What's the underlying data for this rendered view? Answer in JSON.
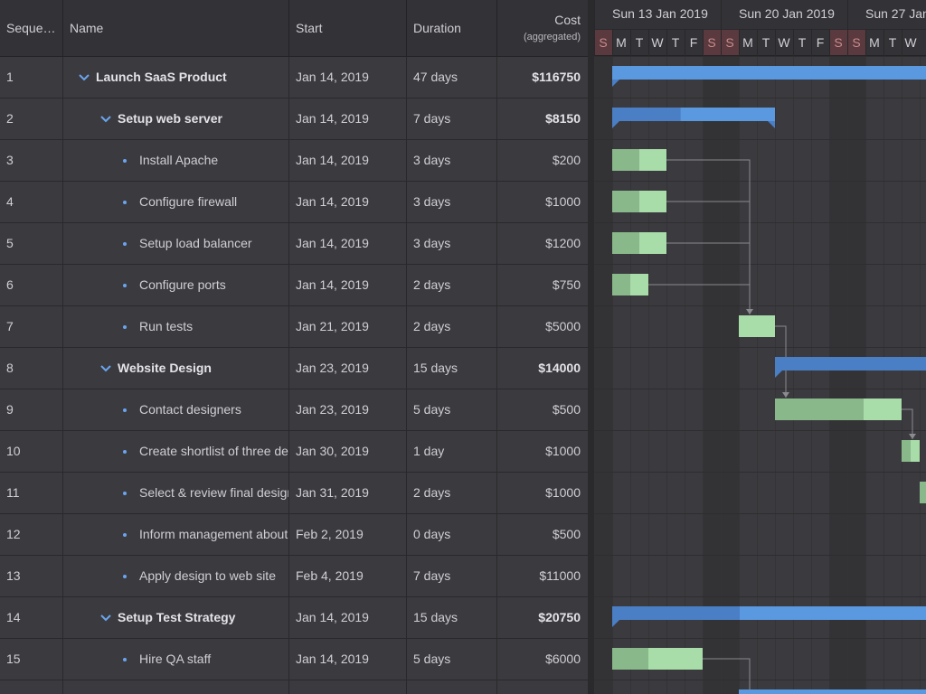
{
  "columns": {
    "seq": "Seque…",
    "name": "Name",
    "start": "Start",
    "duration": "Duration",
    "cost": "Cost",
    "cost_sub": "(aggregated)"
  },
  "timeline": {
    "weeks": [
      "Sun 13 Jan 2019",
      "Sun 20 Jan 2019",
      "Sun 27 Jan"
    ],
    "day_letters": [
      "S",
      "M",
      "T",
      "W",
      "T",
      "F",
      "S",
      "S",
      "M",
      "T",
      "W",
      "T",
      "F",
      "S",
      "S",
      "M",
      "T",
      "W"
    ]
  },
  "rows": [
    {
      "seq": "1",
      "name": "Launch SaaS Product",
      "start": "Jan 14, 2019",
      "duration": "47 days",
      "cost": "$116750",
      "level": 0,
      "parent": true
    },
    {
      "seq": "2",
      "name": "Setup web server",
      "start": "Jan 14, 2019",
      "duration": "7 days",
      "cost": "$8150",
      "level": 1,
      "parent": true
    },
    {
      "seq": "3",
      "name": "Install Apache",
      "start": "Jan 14, 2019",
      "duration": "3 days",
      "cost": "$200",
      "level": 2,
      "parent": false
    },
    {
      "seq": "4",
      "name": "Configure firewall",
      "start": "Jan 14, 2019",
      "duration": "3 days",
      "cost": "$1000",
      "level": 2,
      "parent": false
    },
    {
      "seq": "5",
      "name": "Setup load balancer",
      "start": "Jan 14, 2019",
      "duration": "3 days",
      "cost": "$1200",
      "level": 2,
      "parent": false
    },
    {
      "seq": "6",
      "name": "Configure ports",
      "start": "Jan 14, 2019",
      "duration": "2 days",
      "cost": "$750",
      "level": 2,
      "parent": false
    },
    {
      "seq": "7",
      "name": "Run tests",
      "start": "Jan 21, 2019",
      "duration": "2 days",
      "cost": "$5000",
      "level": 2,
      "parent": false
    },
    {
      "seq": "8",
      "name": "Website Design",
      "start": "Jan 23, 2019",
      "duration": "15 days",
      "cost": "$14000",
      "level": 1,
      "parent": true
    },
    {
      "seq": "9",
      "name": "Contact designers",
      "start": "Jan 23, 2019",
      "duration": "5 days",
      "cost": "$500",
      "level": 2,
      "parent": false
    },
    {
      "seq": "10",
      "name": "Create shortlist of three de",
      "start": "Jan 30, 2019",
      "duration": "1 day",
      "cost": "$1000",
      "level": 2,
      "parent": false
    },
    {
      "seq": "11",
      "name": "Select & review final design",
      "start": "Jan 31, 2019",
      "duration": "2 days",
      "cost": "$1000",
      "level": 2,
      "parent": false
    },
    {
      "seq": "12",
      "name": "Inform management about",
      "start": "Feb 2, 2019",
      "duration": "0 days",
      "cost": "$500",
      "level": 2,
      "parent": false
    },
    {
      "seq": "13",
      "name": "Apply design to web site",
      "start": "Feb 4, 2019",
      "duration": "7 days",
      "cost": "$11000",
      "level": 2,
      "parent": false
    },
    {
      "seq": "14",
      "name": "Setup Test Strategy",
      "start": "Jan 14, 2019",
      "duration": "15 days",
      "cost": "$20750",
      "level": 1,
      "parent": true
    },
    {
      "seq": "15",
      "name": "Hire QA staff",
      "start": "Jan 14, 2019",
      "duration": "5 days",
      "cost": "$6000",
      "level": 2,
      "parent": false
    },
    {
      "seq": "",
      "name": "",
      "start": "",
      "duration": "",
      "cost": "",
      "level": 2,
      "parent": false
    }
  ],
  "bars": [
    {
      "row": 0,
      "type": "summary",
      "startDay": 1,
      "days": 47,
      "progress": 0
    },
    {
      "row": 1,
      "type": "summary",
      "startDay": 1,
      "days": 9,
      "progress": 0.42
    },
    {
      "row": 2,
      "type": "task",
      "startDay": 1,
      "days": 3,
      "progress": 0.5
    },
    {
      "row": 3,
      "type": "task",
      "startDay": 1,
      "days": 3,
      "progress": 0.5
    },
    {
      "row": 4,
      "type": "task",
      "startDay": 1,
      "days": 3,
      "progress": 0.5
    },
    {
      "row": 5,
      "type": "task",
      "startDay": 1,
      "days": 2,
      "progress": 0.5
    },
    {
      "row": 6,
      "type": "task",
      "startDay": 8,
      "days": 2,
      "progress": 0
    },
    {
      "row": 7,
      "type": "summary",
      "startDay": 10,
      "days": 15,
      "progress": 0.8
    },
    {
      "row": 8,
      "type": "task",
      "startDay": 10,
      "days": 7,
      "progress": 0.7
    },
    {
      "row": 9,
      "type": "task",
      "startDay": 17,
      "days": 1,
      "progress": 0.5
    },
    {
      "row": 10,
      "type": "task",
      "startDay": 18,
      "days": 2,
      "progress": 0.5
    },
    {
      "row": 13,
      "type": "summary",
      "startDay": 1,
      "days": 47,
      "progress": 0.15
    },
    {
      "row": 14,
      "type": "task",
      "startDay": 1,
      "days": 5,
      "progress": 0.4
    },
    {
      "row": 15,
      "type": "summary",
      "startDay": 8,
      "days": 20,
      "progress": 0
    }
  ],
  "colors": {
    "summary": "#5a98e0",
    "summary_done": "#4a7fc6",
    "task": "#a8dca9",
    "task_done": "#89b98a",
    "weekend_header": "#5a3a3e",
    "weekend_text": "#c98a8d",
    "dependency": "#8a8a8f",
    "chevron": "#6aa5f0"
  }
}
